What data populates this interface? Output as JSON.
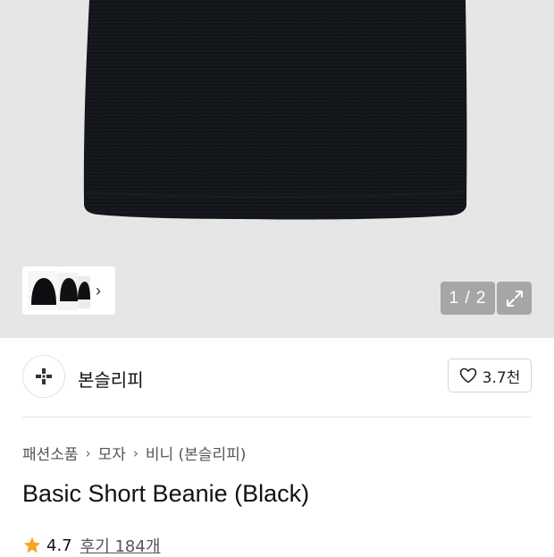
{
  "gallery": {
    "counter": "1 / 2",
    "thumb_chevron": "›",
    "expand_icon": "expand-icon"
  },
  "brand": {
    "name": "본슬리피",
    "logo_icon": "plus-icon",
    "likes": "3.7천",
    "like_icon": "heart-icon"
  },
  "breadcrumb": {
    "items": [
      "패션소품",
      "모자",
      "비니 (본슬리피)"
    ],
    "separator": "›"
  },
  "product": {
    "title": "Basic Short Beanie (Black)",
    "rating": "4.7",
    "reviews": "후기 184개",
    "star_color": "#f5a623"
  },
  "colors": {
    "hero_bg": "#e6e6e6",
    "overlay_button": "#a6a6a6"
  }
}
